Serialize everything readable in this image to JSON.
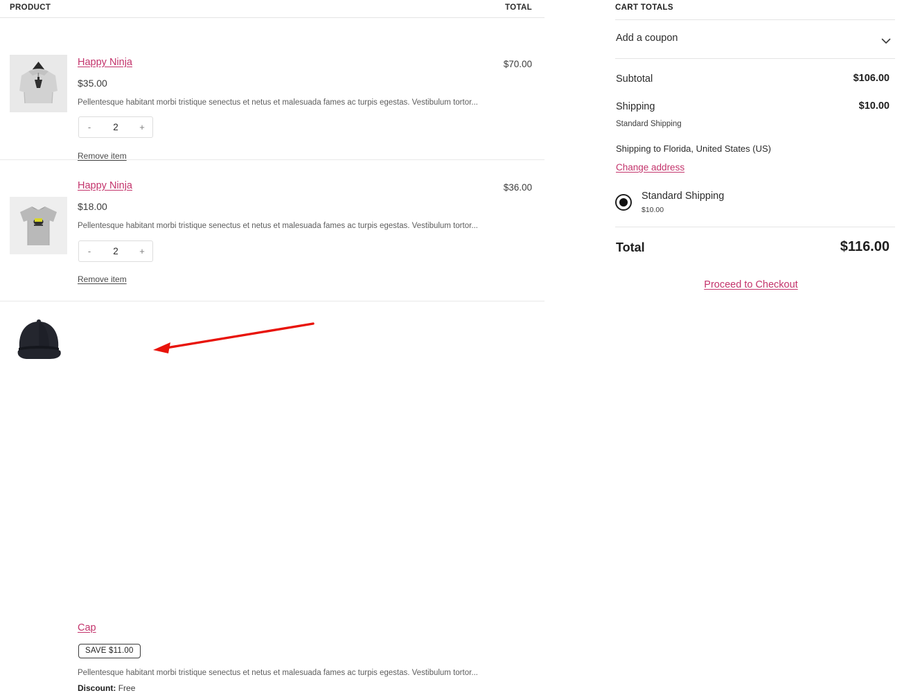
{
  "cart_table": {
    "header": {
      "product": "PRODUCT",
      "total": "TOTAL"
    },
    "items": [
      {
        "name": "Happy Ninja",
        "price": "$35.00",
        "description": "Pellentesque habitant morbi tristique senectus et netus et malesuada fames ac turpis egestas. Vestibulum tortor...",
        "quantity": "2",
        "minus_label": "-",
        "plus_label": "+",
        "remove_label": "Remove item",
        "line_total": "$70.00",
        "thumb": "hoodie-image"
      },
      {
        "name": "Happy Ninja",
        "price": "$18.00",
        "description": "Pellentesque habitant morbi tristique senectus et netus et malesuada fames ac turpis egestas. Vestibulum tortor...",
        "quantity": "2",
        "minus_label": "-",
        "plus_label": "+",
        "remove_label": "Remove item",
        "line_total": "$36.00",
        "thumb": "tshirt-image"
      },
      {
        "name": "Cap",
        "save_badge": "SAVE $11.00",
        "description": "Pellentesque habitant morbi tristique senectus et netus et malesuada fames ac turpis egestas. Vestibulum tortor...",
        "discount_key": "Discount:",
        "discount_value": "Free",
        "thumb": "cap-image"
      }
    ]
  },
  "cart_totals": {
    "title": "CART TOTALS",
    "coupon": {
      "label": "Add a coupon",
      "icon": "chevron-down-icon"
    },
    "subtotal": {
      "key": "Subtotal",
      "value": "$106.00"
    },
    "shipping": {
      "key": "Shipping",
      "value": "$10.00",
      "note": "Standard Shipping"
    },
    "shipping_to": "Shipping to Florida, United States (US)",
    "change_address": "Change address",
    "shipping_option": {
      "label": "Standard Shipping",
      "price": "$10.00",
      "selected": true
    },
    "total": {
      "key": "Total",
      "value": "$116.00"
    },
    "checkout_label": "Proceed to Checkout"
  },
  "annotation": {
    "type": "arrow",
    "color": "#e8130a",
    "points_to": "save-badge"
  },
  "colors": {
    "link": "#c3336b",
    "text": "#2b2b2b",
    "border": "#e4e4e4",
    "annotation_red": "#e8130a"
  }
}
